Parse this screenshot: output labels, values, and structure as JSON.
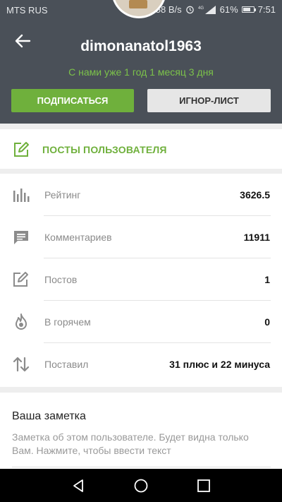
{
  "status_bar": {
    "carrier": "MTS RUS",
    "speed": "58 B/s",
    "network": "4G",
    "battery": "61%",
    "battery_level": 0.61,
    "time": "7:51"
  },
  "profile": {
    "username": "dimonanatol1963",
    "membership": "С нами уже 1 год 1 месяц 3 дня",
    "subscribe_label": "ПОДПИСАТЬСЯ",
    "ignore_label": "ИГНОР-ЛИСТ",
    "accent_color": "#6fb03c"
  },
  "posts_link": {
    "label": "ПОСТЫ ПОЛЬЗОВАТЕЛЯ",
    "icon": "edit-icon"
  },
  "stats": [
    {
      "label": "Рейтинг",
      "value": "3626.5",
      "icon": "bar-chart-icon"
    },
    {
      "label": "Комментариев",
      "value": "11911",
      "icon": "comment-icon"
    },
    {
      "label": "Постов",
      "value": "1",
      "icon": "edit-icon"
    },
    {
      "label": "В горячем",
      "value": "0",
      "icon": "fire-icon"
    },
    {
      "label": "Поставил",
      "value": "31 плюс и 22 минуса",
      "icon": "sort-arrows-icon"
    }
  ],
  "note": {
    "title": "Ваша заметка",
    "placeholder": "Заметка об этом пользователе. Будет видна только Вам. Нажмите, чтобы ввести текст"
  }
}
